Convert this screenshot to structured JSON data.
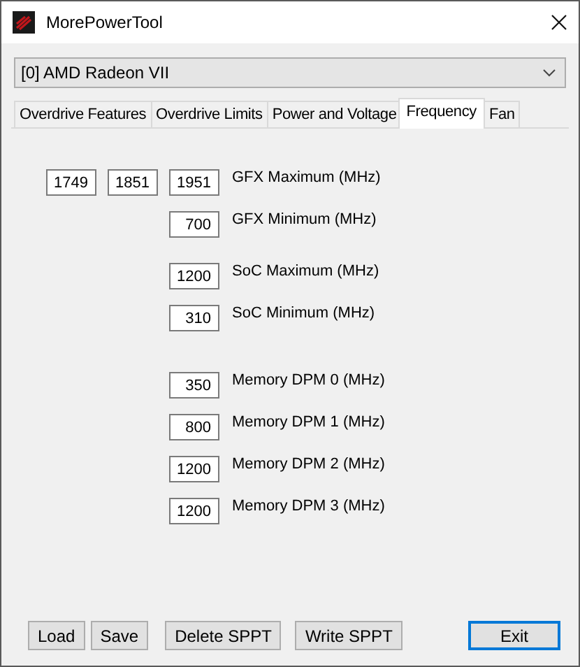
{
  "window": {
    "title": "MorePowerTool"
  },
  "device_select": {
    "value": "[0] AMD Radeon VII"
  },
  "tabs": [
    {
      "label": "Overdrive Features",
      "selected": false
    },
    {
      "label": "Overdrive Limits",
      "selected": false
    },
    {
      "label": "Power and Voltage",
      "selected": false
    },
    {
      "label": "Frequency",
      "selected": true
    },
    {
      "label": "Fan",
      "selected": false
    }
  ],
  "sections": [
    {
      "rows": [
        {
          "values": [
            "1749",
            "1851",
            "1951"
          ],
          "label": "GFX Maximum (MHz)"
        },
        {
          "values": [
            "700"
          ],
          "label": "GFX Minimum (MHz)"
        }
      ]
    },
    {
      "rows": [
        {
          "values": [
            "1200"
          ],
          "label": "SoC Maximum (MHz)"
        },
        {
          "values": [
            "310"
          ],
          "label": "SoC Minimum (MHz)"
        }
      ]
    },
    {
      "rows": [
        {
          "values": [
            "350"
          ],
          "label": "Memory DPM 0 (MHz)"
        },
        {
          "values": [
            "800"
          ],
          "label": "Memory DPM 1 (MHz)"
        },
        {
          "values": [
            "1200"
          ],
          "label": "Memory DPM 2 (MHz)"
        },
        {
          "values": [
            "1200"
          ],
          "label": "Memory DPM 3 (MHz)"
        }
      ]
    }
  ],
  "buttons": [
    {
      "label": "Load",
      "focused": false
    },
    {
      "label": "Save",
      "focused": false
    },
    {
      "label": "Delete SPPT",
      "focused": false
    },
    {
      "label": "Write SPPT",
      "focused": false
    },
    {
      "label": "Exit",
      "focused": true
    }
  ]
}
